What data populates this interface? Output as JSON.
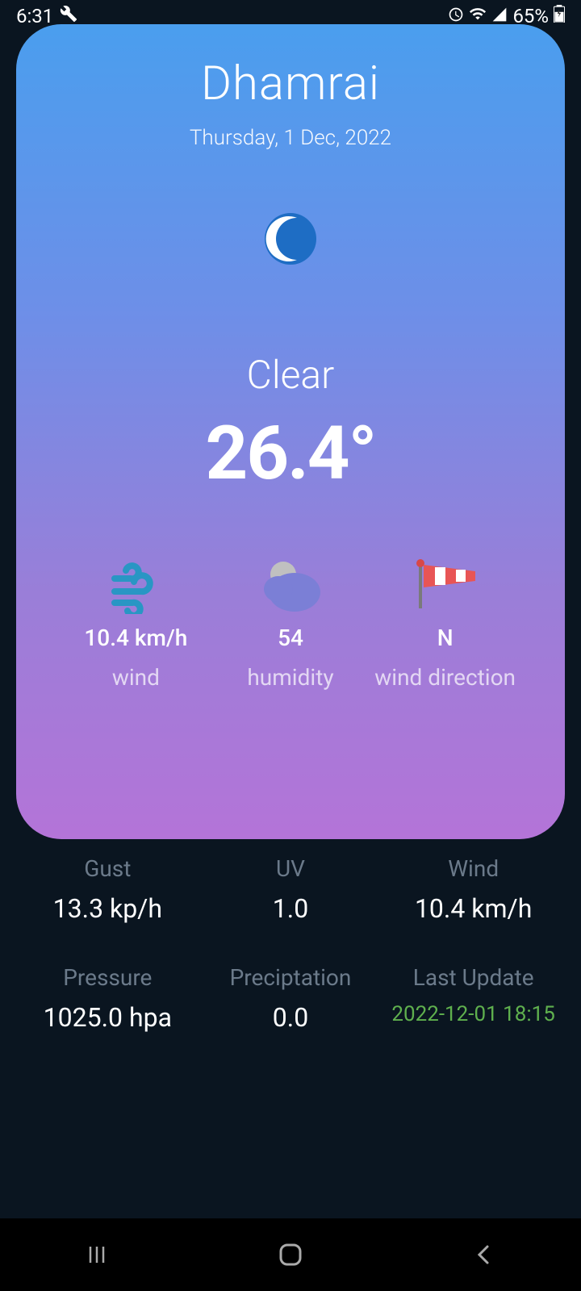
{
  "statusBar": {
    "time": "6:31",
    "battery": "65%"
  },
  "weather": {
    "location": "Dhamrai",
    "date": "Thursday, 1 Dec, 2022",
    "condition": "Clear",
    "temperature": "26.4°",
    "metrics": {
      "wind": {
        "value": "10.4 km/h",
        "label": "wind"
      },
      "humidity": {
        "value": "54",
        "label": "humidity"
      },
      "windDirection": {
        "value": "N",
        "label": "wind direction"
      }
    }
  },
  "details": {
    "gust": {
      "label": "Gust",
      "value": "13.3 kp/h"
    },
    "uv": {
      "label": "UV",
      "value": "1.0"
    },
    "wind": {
      "label": "Wind",
      "value": "10.4 km/h"
    },
    "pressure": {
      "label": "Pressure",
      "value": "1025.0 hpa"
    },
    "precipitation": {
      "label": "Preciptation",
      "value": "0.0"
    },
    "lastUpdate": {
      "label": "Last Update",
      "value": "2022-12-01 18:15"
    }
  }
}
